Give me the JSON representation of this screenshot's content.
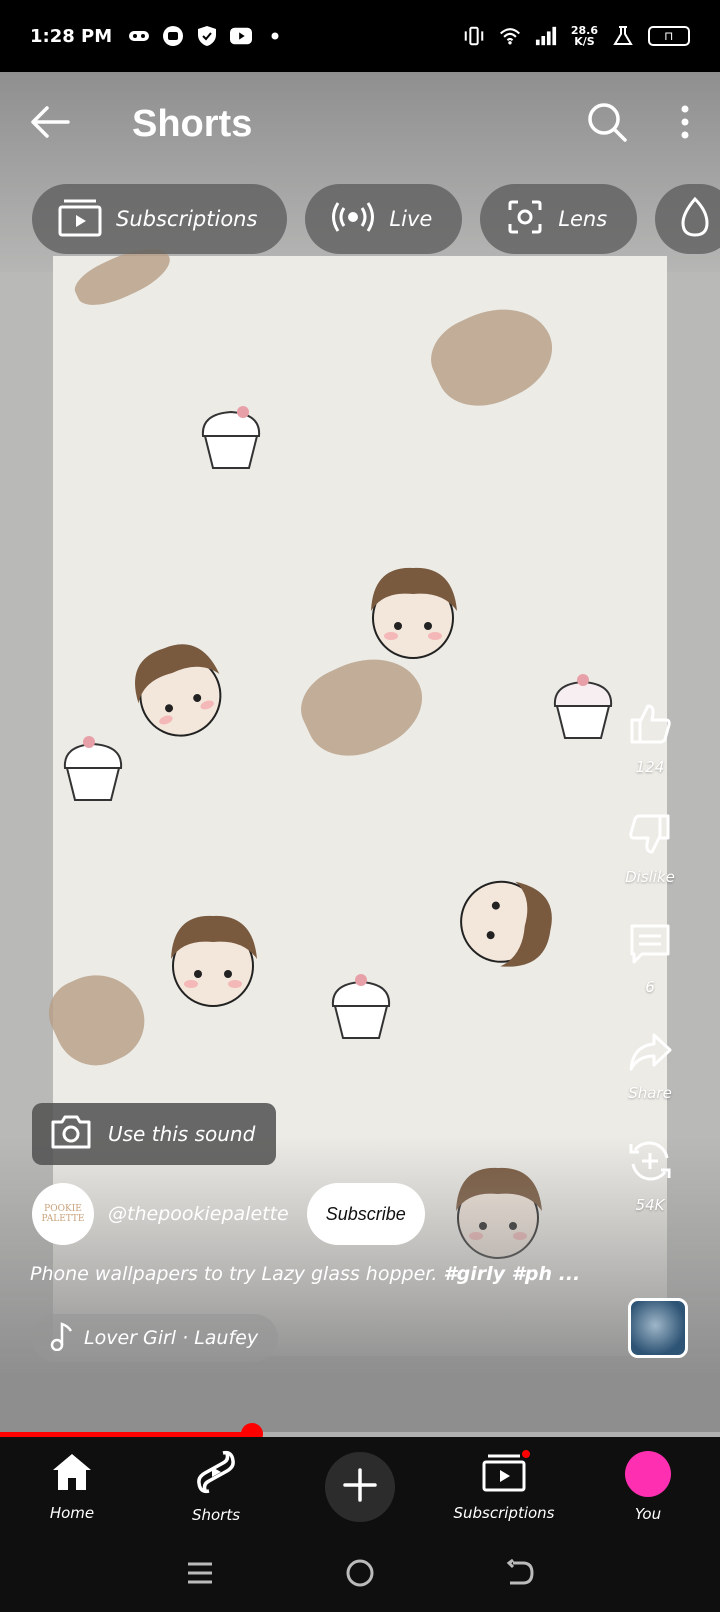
{
  "status_bar": {
    "time": "1:28 PM",
    "net_speed_value": "28.6",
    "net_speed_unit": "K/S"
  },
  "header": {
    "title": "Shorts"
  },
  "chips": [
    {
      "label": "Subscriptions",
      "icon": "subscriptions-icon"
    },
    {
      "label": "Live",
      "icon": "live-icon"
    },
    {
      "label": "Lens",
      "icon": "lens-icon"
    }
  ],
  "actions": {
    "like_count": "124",
    "dislike_label": "Dislike",
    "comment_count": "6",
    "share_label": "Share",
    "remix_count": "54K"
  },
  "use_sound_label": "Use this sound",
  "channel": {
    "handle": "@thepookiepalette",
    "avatar_text": "POOKIE PALETTE",
    "subscribe_label": "Subscribe"
  },
  "description": {
    "text": "Phone wallpapers to try Lazy glass hopper. ",
    "tags": "#girly #ph ..."
  },
  "music": {
    "label": "Lover Girl · Laufey"
  },
  "progress": {
    "fraction": 0.35
  },
  "bottom_nav": [
    {
      "label": "Home"
    },
    {
      "label": "Shorts"
    },
    {
      "label": ""
    },
    {
      "label": "Subscriptions"
    },
    {
      "label": "You"
    }
  ],
  "colors": {
    "accent": "#ff0000",
    "chip_bg": "#5a5a5a",
    "nav_bg": "#0f0f0f",
    "wallpaper_bg": "#ecebe6",
    "hair_brown": "#7a5a3f"
  }
}
